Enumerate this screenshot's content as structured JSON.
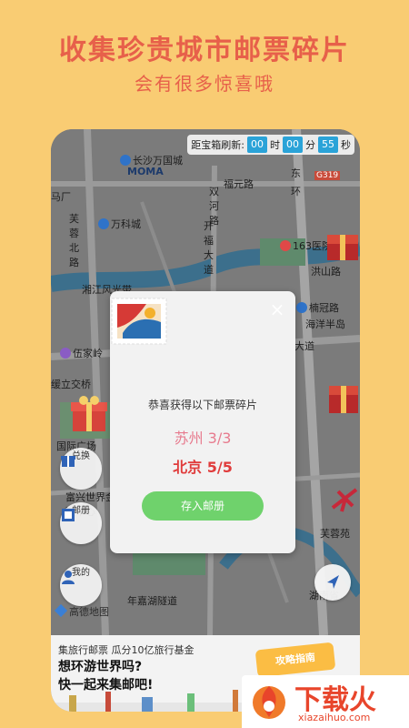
{
  "promo": {
    "headline": "收集珍贵城市邮票碎片",
    "subheadline": "会有很多惊喜哦"
  },
  "timer": {
    "label": "距宝箱刷新:",
    "hours": "00",
    "hours_unit": "时",
    "minutes": "00",
    "minutes_unit": "分",
    "seconds": "55",
    "seconds_unit": "秒"
  },
  "map": {
    "labels": [
      "长沙万国城",
      "MOMA",
      "福元路",
      "东",
      "环",
      "G319",
      "马厂",
      "芙蓉北路",
      "万科城",
      "双河路",
      "开福大道",
      "163医院",
      "湘江风光带",
      "洪山路",
      "楠冠路",
      "海洋半岛",
      "伍家岭",
      "大道",
      "缓立交桥",
      "国际广场",
      "富兴世界金融中心",
      "芙蓉苑",
      "年嘉湖隧道",
      "湖南省"
    ],
    "provider": "高德地图"
  },
  "side_buttons": {
    "exchange": "兑换",
    "album": "邮册",
    "mine": "我的"
  },
  "modal": {
    "congrats": "恭喜获得以下邮票碎片",
    "city1": "苏州 3/3",
    "city2": "北京 5/5",
    "save_button": "存入邮册",
    "close_icon": "×"
  },
  "banner": {
    "line1": "集旅行邮票 瓜分10亿旅行基金",
    "line2": "想环游世界吗?",
    "line3": "快一起来集邮吧!",
    "guide_button": "攻略指南"
  },
  "watermark": {
    "text": "下载火",
    "url": "xiazaihuo.com"
  },
  "colors": {
    "background": "#f9cc73",
    "headline": "#e7604a",
    "timer_box": "#2aa3d8",
    "save_button": "#6fd26c",
    "city1": "#e77b8e",
    "city2": "#e03c3c"
  }
}
